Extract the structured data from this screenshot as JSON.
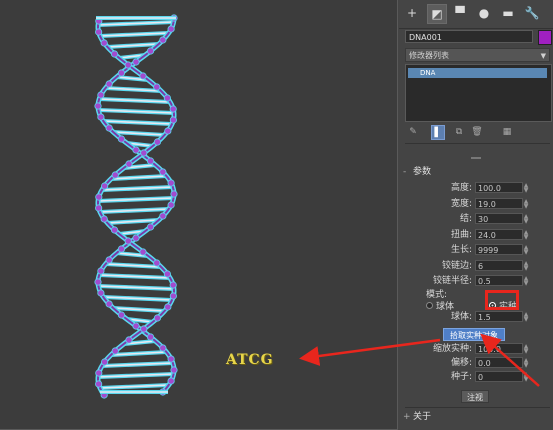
{
  "viewport": {
    "label_text": "ATCG",
    "helix_color": "#5ad8f0",
    "atom_color": "#a24bcf"
  },
  "command_panel": {
    "tabs": [
      {
        "name": "create",
        "glyph": "+"
      },
      {
        "name": "modify",
        "glyph": "◩"
      },
      {
        "name": "hierarchy",
        "glyph": "▀"
      },
      {
        "name": "motion",
        "glyph": "●"
      },
      {
        "name": "display",
        "glyph": "▬"
      },
      {
        "name": "utilities",
        "glyph": "🔧"
      }
    ],
    "object_name": "DNA001",
    "object_color": "#a020c0",
    "modifier_list_label": "修改器列表",
    "stack_items": [
      "DNA"
    ]
  },
  "params": {
    "header": "参数",
    "header_sign": "-",
    "rows": [
      {
        "label": "高度:",
        "value": "100.0"
      },
      {
        "label": "宽度:",
        "value": "19.0"
      },
      {
        "label": "结:",
        "value": "30"
      },
      {
        "label": "扭曲:",
        "value": "24.0"
      },
      {
        "label": "生长:",
        "value": "9999"
      },
      {
        "label": "铰链边:",
        "value": "6"
      },
      {
        "label": "铰链半径:",
        "value": "0.5"
      }
    ],
    "mode_label": "模式:",
    "mode_options": [
      {
        "label": "球体",
        "selected": false
      },
      {
        "label": "实种",
        "selected": true
      }
    ],
    "sphere_row": {
      "label": "球体:",
      "value": "1.5"
    },
    "pick_button": "拾取实种对象",
    "rows2": [
      {
        "label": "缩放实种:",
        "value": "100.0"
      },
      {
        "label": "偏移:",
        "value": "0.0"
      },
      {
        "label": "种子:",
        "value": "0"
      }
    ],
    "note_button": "注视"
  },
  "about": {
    "header": "关于",
    "header_sign": "+"
  },
  "annotation_color": "#e8261d"
}
